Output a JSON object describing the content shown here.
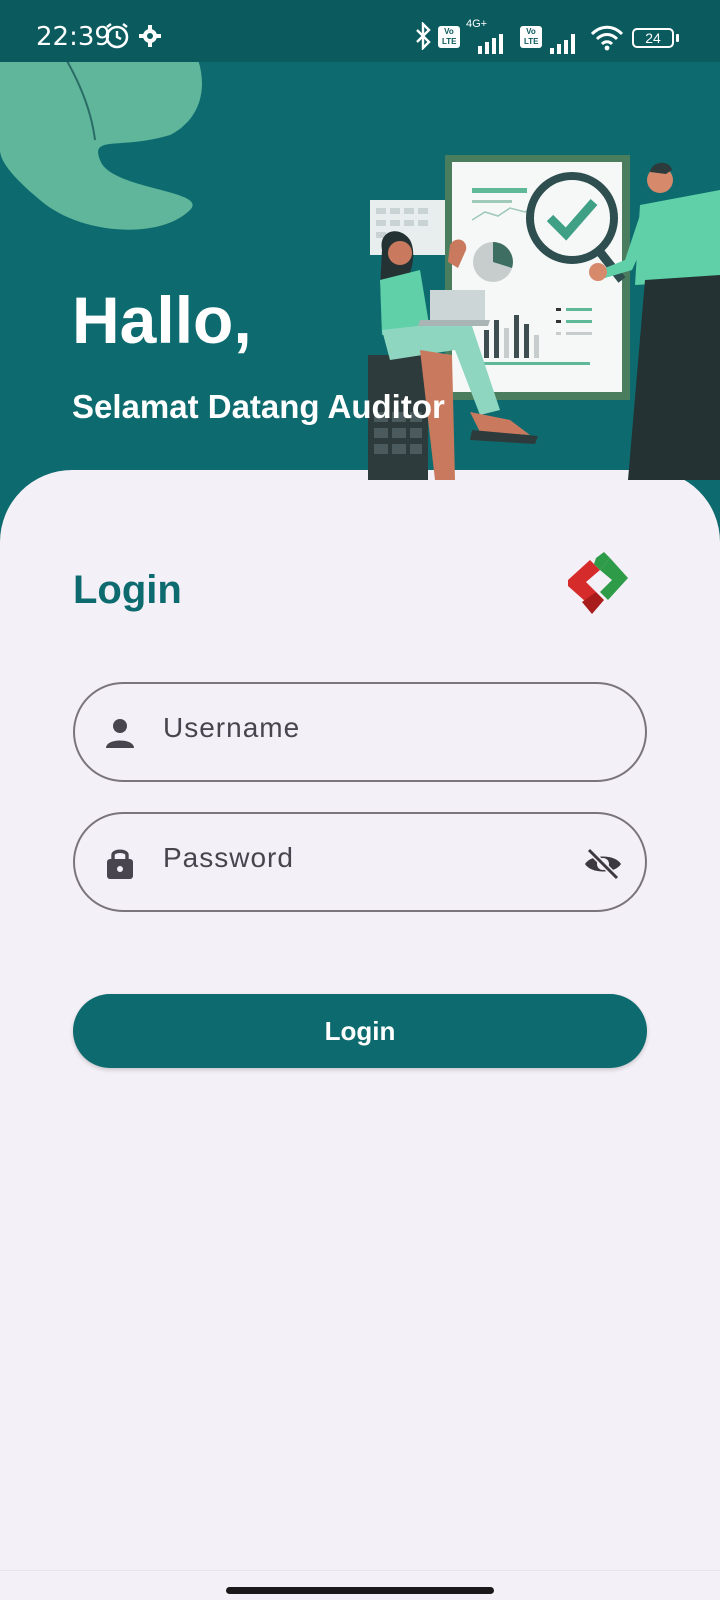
{
  "status_bar": {
    "time": "22:39",
    "icons": [
      "alarm-icon",
      "settings-gear-icon",
      "bluetooth-icon",
      "volte-icon",
      "signal-4g-icon",
      "volte-icon",
      "signal-icon",
      "wifi-icon",
      "battery-icon"
    ],
    "network_label": "4G+",
    "volte_label": "Vo LTE",
    "battery_level": "24"
  },
  "header": {
    "greeting": "Hallo,",
    "welcome": "Selamat Datang Auditor"
  },
  "login": {
    "title": "Login",
    "username_placeholder": "Username",
    "password_placeholder": "Password",
    "button_label": "Login"
  },
  "colors": {
    "primary": "#0d6b6f",
    "background": "#f4f0f7",
    "accent": "#5fb898"
  }
}
